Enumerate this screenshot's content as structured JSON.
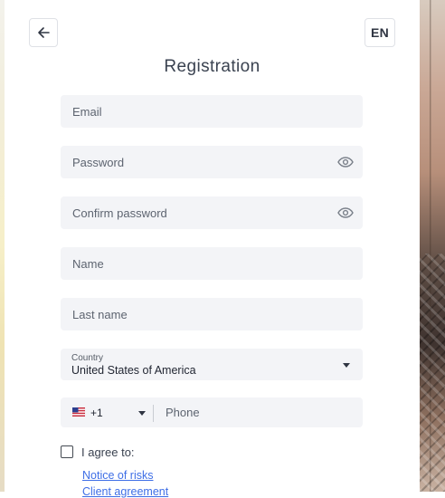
{
  "header": {
    "back_icon": "arrow-left-icon",
    "language": "EN",
    "title": "Registration"
  },
  "form": {
    "email": {
      "placeholder": "Email",
      "value": ""
    },
    "password": {
      "placeholder": "Password",
      "value": "",
      "icon": "eye-icon"
    },
    "confirm_password": {
      "placeholder": "Confirm password",
      "value": "",
      "icon": "eye-icon"
    },
    "name": {
      "placeholder": "Name",
      "value": ""
    },
    "last_name": {
      "placeholder": "Last name",
      "value": ""
    },
    "country": {
      "label": "Country",
      "value": "United States of America"
    },
    "phone": {
      "flag_icon": "us-flag-icon",
      "code": "+1",
      "placeholder": "Phone",
      "value": ""
    }
  },
  "agreement": {
    "label": "I agree to:",
    "checked": false,
    "links": [
      "Notice of risks",
      "Client agreement"
    ]
  },
  "colors": {
    "field_bg": "#f3f4f7",
    "link": "#3e6ee6",
    "text": "#3a4250"
  }
}
